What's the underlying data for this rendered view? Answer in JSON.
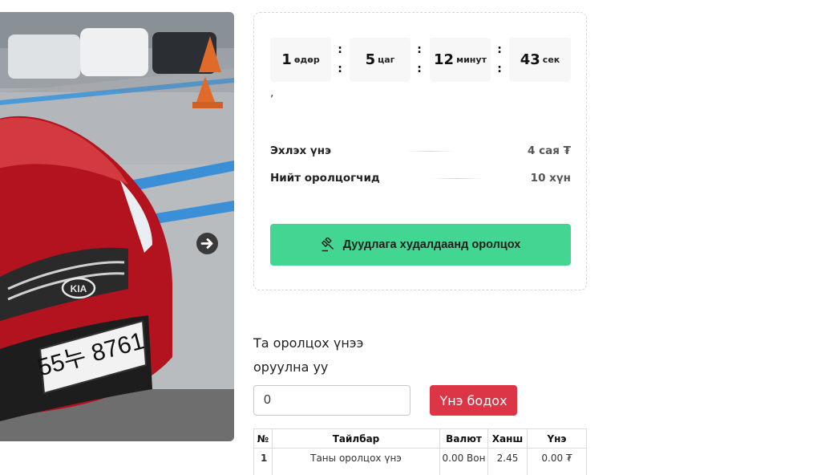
{
  "gallery": {
    "plate_text": "55누 8761",
    "next_icon": "arrow-right-circle-icon"
  },
  "countdown": [
    {
      "value": "1",
      "unit": "өдөр"
    },
    {
      "value": "5",
      "unit": "цаг"
    },
    {
      "value": "12",
      "unit": "минут"
    },
    {
      "value": "43",
      "unit": "сек"
    }
  ],
  "countdown_separator": ":",
  "stray_text": ",",
  "info": {
    "start_price_label": "Эхлэх үнэ",
    "start_price_value": "4 сая ₮",
    "participants_label": "Нийт оролцогчид",
    "participants_value": "10 хүн"
  },
  "join_button": {
    "label": "Дуудлага худалдаанд оролцох",
    "icon": "gavel-icon",
    "color": "#43d693"
  },
  "bid": {
    "line1": "Та оролцох үнээ",
    "line2": "оруулна уу",
    "input_value": "0",
    "calc_button": "Үнэ бодох",
    "calc_color": "#dc3545"
  },
  "table": {
    "headers": [
      "№",
      "Тайлбар",
      "Валют",
      "Ханш",
      "Үнэ"
    ],
    "rows": [
      {
        "idx": "1",
        "desc": "Таны оролцох үнэ",
        "currency": "0.00 Вон",
        "rate": "2.45",
        "price": "0.00 ₮"
      }
    ]
  }
}
